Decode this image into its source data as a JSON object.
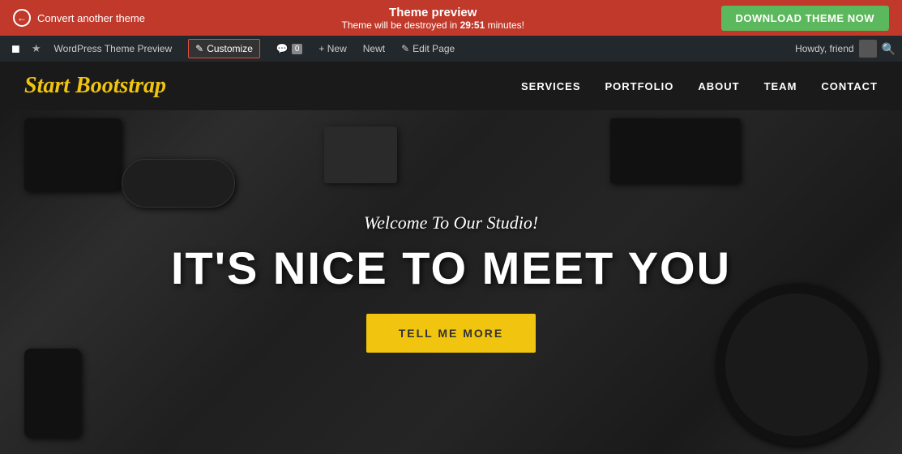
{
  "banner": {
    "back_label": "Convert another theme",
    "title": "Theme preview",
    "subtitle_pre": "Theme will be destroyed in ",
    "countdown": "29:51",
    "subtitle_post": " minutes!",
    "download_label": "DOWNLOAD THEME NOW"
  },
  "admin_bar": {
    "wp_icon": "⊞",
    "theme_preview_label": "WordPress Theme Preview",
    "customize_label": "Customize",
    "comment_count": "0",
    "new_label": "+ New",
    "new_item": "Newt",
    "edit_label": "Edit Page",
    "howdy": "Howdy, friend",
    "search_title": "Search"
  },
  "site_header": {
    "logo": "Start Bootstrap",
    "nav": [
      {
        "label": "SERVICES"
      },
      {
        "label": "PORTFOLIO"
      },
      {
        "label": "ABOUT"
      },
      {
        "label": "TEAM"
      },
      {
        "label": "CONTACT"
      }
    ]
  },
  "hero": {
    "subtitle": "Welcome To Our Studio!",
    "title": "IT'S NICE TO MEET YOU",
    "cta_label": "TELL ME MORE"
  },
  "colors": {
    "banner_bg": "#c0392b",
    "admin_bg": "#23282d",
    "site_header_bg": "#1a1a1a",
    "logo_color": "#f1c40f",
    "hero_bg": "#1a1a1a",
    "cta_bg": "#f1c40f",
    "download_btn_bg": "#5cb85c",
    "customize_border": "#e74c3c"
  }
}
